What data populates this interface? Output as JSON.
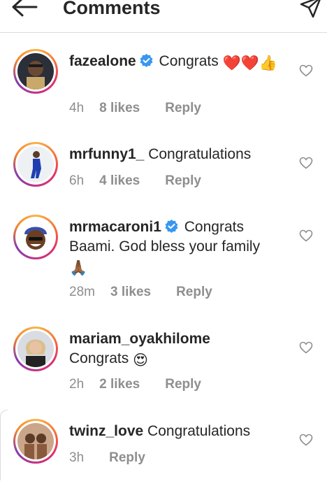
{
  "header": {
    "title": "Comments",
    "back_icon": "arrow-left-icon",
    "send_icon": "direct-send-icon"
  },
  "comments": [
    {
      "username": "fazealone",
      "verified": true,
      "text": "Congrats",
      "emoji": "❤️❤️👍",
      "time": "4h",
      "likes": "8 likes",
      "reply": "Reply"
    },
    {
      "username": "mrfunny1_",
      "verified": false,
      "text": "Congratulations",
      "time": "6h",
      "likes": "4 likes",
      "reply": "Reply"
    },
    {
      "username": "mrmacaroni1",
      "verified": true,
      "text": "Congrats",
      "text_line2": "Baami. God bless your family",
      "emoji": "🙏🏾",
      "time": "28m",
      "likes": "3 likes",
      "reply": "Reply"
    },
    {
      "username": "mariam_oyakhilome",
      "verified": false,
      "text": "Congrats",
      "emoji": "😍",
      "time": "2h",
      "likes": "2 likes",
      "reply": "Reply"
    },
    {
      "username": "twinz_love",
      "verified": false,
      "text": "Congratulations",
      "time": "3h",
      "reply": "Reply"
    }
  ],
  "colors": {
    "verified_blue": "#3897f0",
    "muted": "#8e8e8e",
    "text": "#262626"
  }
}
